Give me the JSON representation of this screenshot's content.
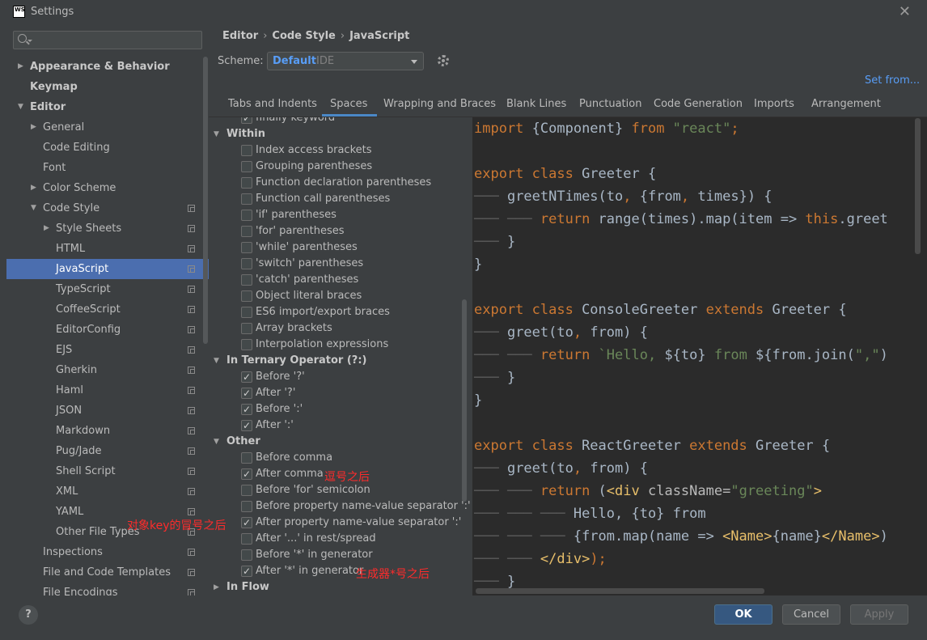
{
  "window": {
    "logo_text": "WS",
    "title": "Settings",
    "close": "✕"
  },
  "search": {
    "placeholder": ""
  },
  "sidebar": [
    {
      "label": "Appearance & Behavior",
      "arrow": "▶",
      "level": 0,
      "bold": true,
      "copy": false
    },
    {
      "label": "Keymap",
      "arrow": "",
      "level": 0,
      "bold": true,
      "copy": false
    },
    {
      "label": "Editor",
      "arrow": "▼",
      "level": 0,
      "bold": true,
      "copy": false
    },
    {
      "label": "General",
      "arrow": "▶",
      "level": 1,
      "bold": false,
      "copy": false
    },
    {
      "label": "Code Editing",
      "arrow": "",
      "level": 1,
      "bold": false,
      "copy": false
    },
    {
      "label": "Font",
      "arrow": "",
      "level": 1,
      "bold": false,
      "copy": false
    },
    {
      "label": "Color Scheme",
      "arrow": "▶",
      "level": 1,
      "bold": false,
      "copy": false
    },
    {
      "label": "Code Style",
      "arrow": "▼",
      "level": 1,
      "bold": false,
      "copy": true
    },
    {
      "label": "Style Sheets",
      "arrow": "▶",
      "level": 2,
      "bold": false,
      "copy": true
    },
    {
      "label": "HTML",
      "arrow": "",
      "level": 2,
      "bold": false,
      "copy": true
    },
    {
      "label": "JavaScript",
      "arrow": "",
      "level": 2,
      "bold": false,
      "copy": true,
      "selected": true
    },
    {
      "label": "TypeScript",
      "arrow": "",
      "level": 2,
      "bold": false,
      "copy": true
    },
    {
      "label": "CoffeeScript",
      "arrow": "",
      "level": 2,
      "bold": false,
      "copy": true
    },
    {
      "label": "EditorConfig",
      "arrow": "",
      "level": 2,
      "bold": false,
      "copy": true
    },
    {
      "label": "EJS",
      "arrow": "",
      "level": 2,
      "bold": false,
      "copy": true
    },
    {
      "label": "Gherkin",
      "arrow": "",
      "level": 2,
      "bold": false,
      "copy": true
    },
    {
      "label": "Haml",
      "arrow": "",
      "level": 2,
      "bold": false,
      "copy": true
    },
    {
      "label": "JSON",
      "arrow": "",
      "level": 2,
      "bold": false,
      "copy": true
    },
    {
      "label": "Markdown",
      "arrow": "",
      "level": 2,
      "bold": false,
      "copy": true
    },
    {
      "label": "Pug/Jade",
      "arrow": "",
      "level": 2,
      "bold": false,
      "copy": true
    },
    {
      "label": "Shell Script",
      "arrow": "",
      "level": 2,
      "bold": false,
      "copy": true
    },
    {
      "label": "XML",
      "arrow": "",
      "level": 2,
      "bold": false,
      "copy": true
    },
    {
      "label": "YAML",
      "arrow": "",
      "level": 2,
      "bold": false,
      "copy": true
    },
    {
      "label": "Other File Types",
      "arrow": "",
      "level": 2,
      "bold": false,
      "copy": true
    },
    {
      "label": "Inspections",
      "arrow": "",
      "level": 1,
      "bold": false,
      "copy": true
    },
    {
      "label": "File and Code Templates",
      "arrow": "",
      "level": 1,
      "bold": false,
      "copy": true
    },
    {
      "label": "File Encodings",
      "arrow": "",
      "level": 1,
      "bold": false,
      "copy": true
    }
  ],
  "breadcrumb": [
    "Editor",
    "Code Style",
    "JavaScript"
  ],
  "breadcrumb_sep": "›",
  "scheme": {
    "label": "Scheme:",
    "value": "Default",
    "suffix": "IDE"
  },
  "set_from": "Set from...",
  "tabs": [
    "Tabs and Indents",
    "Spaces",
    "Wrapping and Braces",
    "Blank Lines",
    "Punctuation",
    "Code Generation",
    "Imports",
    "Arrangement"
  ],
  "active_tab": "Spaces",
  "options": [
    {
      "type": "item",
      "label": "finally  keyword",
      "checked": true
    },
    {
      "type": "section",
      "label": "Within",
      "arrow": "▼"
    },
    {
      "type": "item",
      "label": "Index access brackets",
      "checked": false
    },
    {
      "type": "item",
      "label": "Grouping parentheses",
      "checked": false
    },
    {
      "type": "item",
      "label": "Function declaration parentheses",
      "checked": false
    },
    {
      "type": "item",
      "label": "Function call parentheses",
      "checked": false
    },
    {
      "type": "item",
      "label": "'if' parentheses",
      "checked": false
    },
    {
      "type": "item",
      "label": "'for' parentheses",
      "checked": false
    },
    {
      "type": "item",
      "label": "'while' parentheses",
      "checked": false
    },
    {
      "type": "item",
      "label": "'switch' parentheses",
      "checked": false
    },
    {
      "type": "item",
      "label": "'catch' parentheses",
      "checked": false
    },
    {
      "type": "item",
      "label": "Object literal braces",
      "checked": false
    },
    {
      "type": "item",
      "label": "ES6 import/export braces",
      "checked": false
    },
    {
      "type": "item",
      "label": "Array brackets",
      "checked": false
    },
    {
      "type": "item",
      "label": "Interpolation expressions",
      "checked": false
    },
    {
      "type": "section",
      "label": "In Ternary Operator (?:)",
      "arrow": "▼"
    },
    {
      "type": "item",
      "label": "Before '?'",
      "checked": true
    },
    {
      "type": "item",
      "label": "After '?'",
      "checked": true
    },
    {
      "type": "item",
      "label": "Before ':'",
      "checked": true
    },
    {
      "type": "item",
      "label": "After ':'",
      "checked": true
    },
    {
      "type": "section",
      "label": "Other",
      "arrow": "▼"
    },
    {
      "type": "item",
      "label": "Before comma",
      "checked": false
    },
    {
      "type": "item",
      "label": "After comma",
      "checked": true
    },
    {
      "type": "item",
      "label": "Before 'for' semicolon",
      "checked": false
    },
    {
      "type": "item",
      "label": "Before property name-value separator ':'",
      "checked": false
    },
    {
      "type": "item",
      "label": "After property name-value separator ':'",
      "checked": true
    },
    {
      "type": "item",
      "label": "After '...' in rest/spread",
      "checked": false
    },
    {
      "type": "item",
      "label": "Before '*' in generator",
      "checked": false
    },
    {
      "type": "item",
      "label": "After '*' in generator",
      "checked": true
    },
    {
      "type": "section",
      "label": "In Flow",
      "arrow": "▶"
    }
  ],
  "annotations": {
    "after_comma": "逗号之后",
    "object_key_colon": "对象key的冒号之后",
    "generator_star": "生成器*号之后"
  },
  "code_lines": [
    [
      [
        "kw",
        "import "
      ],
      [
        "cls",
        "{Component} "
      ],
      [
        "kw",
        "from "
      ],
      [
        "str",
        "\"react\""
      ],
      [
        "kw",
        ";"
      ]
    ],
    [],
    [
      [
        "kw",
        "export class "
      ],
      [
        "cls",
        "Greeter {"
      ]
    ],
    [
      [
        "ind",
        "─── "
      ],
      [
        "cls",
        "greetNTimes(to"
      ],
      [
        "kw",
        ", "
      ],
      [
        "cls",
        "{from"
      ],
      [
        "kw",
        ", "
      ],
      [
        "cls",
        "times}) {"
      ]
    ],
    [
      [
        "ind",
        "─── ─── "
      ],
      [
        "kw",
        "return "
      ],
      [
        "cls",
        "range(times).map(item => "
      ],
      [
        "this",
        "this"
      ],
      [
        "cls",
        ".greet"
      ]
    ],
    [
      [
        "ind",
        "─── "
      ],
      [
        "cls",
        "}"
      ]
    ],
    [
      [
        "cls",
        "}"
      ]
    ],
    [],
    [
      [
        "kw",
        "export class "
      ],
      [
        "cls",
        "ConsoleGreeter "
      ],
      [
        "kw",
        "extends "
      ],
      [
        "cls",
        "Greeter {"
      ]
    ],
    [
      [
        "ind",
        "─── "
      ],
      [
        "cls",
        "greet(to"
      ],
      [
        "kw",
        ", "
      ],
      [
        "cls",
        "from) {"
      ]
    ],
    [
      [
        "ind",
        "─── ─── "
      ],
      [
        "kw",
        "return "
      ],
      [
        "str",
        "`Hello, "
      ],
      [
        "cls",
        "${to}"
      ],
      [
        "str",
        " from "
      ],
      [
        "cls",
        "${from.join("
      ],
      [
        "str",
        "\",\""
      ],
      [
        "cls",
        ")"
      ]
    ],
    [
      [
        "ind",
        "─── "
      ],
      [
        "cls",
        "}"
      ]
    ],
    [
      [
        "cls",
        "}"
      ]
    ],
    [],
    [
      [
        "kw",
        "export class "
      ],
      [
        "cls",
        "ReactGreeter "
      ],
      [
        "kw",
        "extends "
      ],
      [
        "cls",
        "Greeter {"
      ]
    ],
    [
      [
        "ind",
        "─── "
      ],
      [
        "cls",
        "greet(to"
      ],
      [
        "kw",
        ", "
      ],
      [
        "cls",
        "from) {"
      ]
    ],
    [
      [
        "ind",
        "─── ─── "
      ],
      [
        "kw",
        "return "
      ],
      [
        "cls",
        "("
      ],
      [
        "tag",
        "<div "
      ],
      [
        "attr",
        "className="
      ],
      [
        "str",
        "\"greeting\""
      ],
      [
        "tag",
        ">"
      ]
    ],
    [
      [
        "ind",
        "─── ─── ─── "
      ],
      [
        "cls",
        "Hello, {to} from"
      ]
    ],
    [
      [
        "ind",
        "─── ─── ─── "
      ],
      [
        "cls",
        "{from.map(name => "
      ],
      [
        "tag",
        "<Name>"
      ],
      [
        "cls",
        "{name}"
      ],
      [
        "tag",
        "</Name>"
      ],
      [
        "cls",
        ")"
      ]
    ],
    [
      [
        "ind",
        "─── ─── "
      ],
      [
        "tag",
        "</div>"
      ],
      [
        "kw",
        ");"
      ]
    ],
    [
      [
        "ind",
        "─── "
      ],
      [
        "cls",
        "}"
      ]
    ]
  ],
  "buttons": {
    "help": "?",
    "ok": "OK",
    "cancel": "Cancel",
    "apply": "Apply"
  }
}
